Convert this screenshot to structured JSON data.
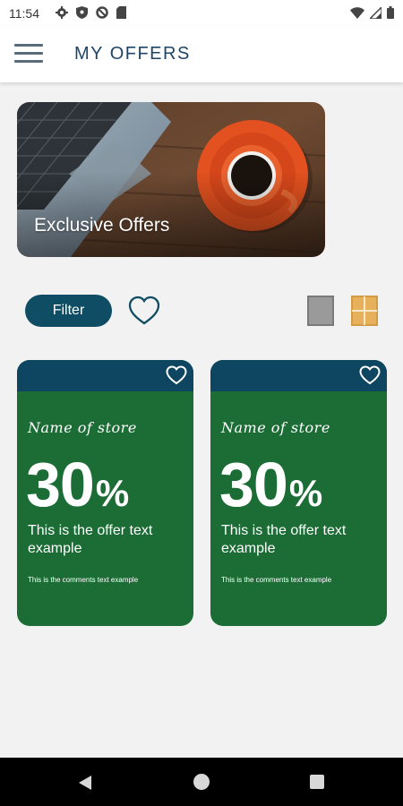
{
  "status_bar": {
    "time": "11:54",
    "left_icons": [
      "gear-icon",
      "shield-icon",
      "no-sync-icon",
      "sd-card-icon"
    ],
    "right_icons": [
      "wifi-icon",
      "signal-icon",
      "battery-icon"
    ]
  },
  "app_bar": {
    "title": "MY OFFERS",
    "menu_icon": "hamburger-menu-icon"
  },
  "banner": {
    "label": "Exclusive Offers",
    "image": "laptop-and-coffee-cup-photo"
  },
  "toolbar": {
    "filter_label": "Filter",
    "favorites_icon": "heart-outline-icon",
    "view_single_icon": "single-view-icon",
    "view_grid_icon": "grid-view-icon",
    "active_view": "grid"
  },
  "offers": [
    {
      "store_name": "Name of store",
      "discount_value": "30",
      "discount_unit": "%",
      "offer_text": "This is the offer text example",
      "comment_text": "This is the comments text example"
    },
    {
      "store_name": "Name of store",
      "discount_value": "30",
      "discount_unit": "%",
      "offer_text": "This is the offer text example",
      "comment_text": "This is the comments text example"
    }
  ],
  "colors": {
    "brand_navy": "#0e4d63",
    "card_green": "#1b6d35",
    "card_header": "#0e4560",
    "grid_accent": "#e6b15a"
  },
  "nav_bar": {
    "back_icon": "back-triangle-icon",
    "home_icon": "home-circle-icon",
    "recents_icon": "recents-square-icon"
  }
}
